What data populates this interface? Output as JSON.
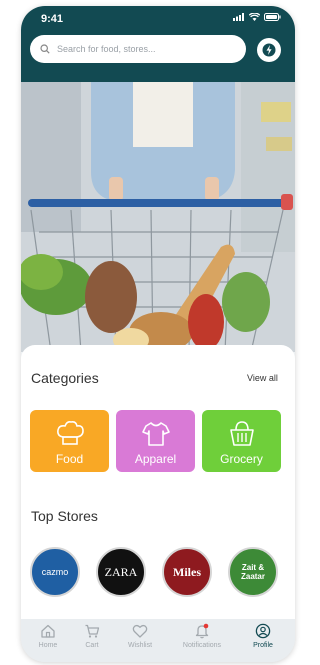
{
  "status": {
    "time": "9:41"
  },
  "search": {
    "placeholder": "Search for food, stores..."
  },
  "categories": {
    "title": "Categories",
    "view_all": "View all",
    "items": [
      {
        "label": "Food",
        "color": "#f9a825"
      },
      {
        "label": "Apparel",
        "color": "#d97ad6"
      },
      {
        "label": "Grocery",
        "color": "#6fcf3a"
      }
    ]
  },
  "top_stores": {
    "title": "Top Stores",
    "items": [
      {
        "logo_text": "cazmo",
        "bg": "#1f5fa3"
      },
      {
        "logo_text": "ZARA",
        "bg": "#111111"
      },
      {
        "logo_text": "Miles",
        "bg": "#8e1a1f"
      },
      {
        "logo_text": "Zait & Zaatar",
        "bg": "#3d8a37"
      }
    ]
  },
  "nav": {
    "items": [
      {
        "label": "Home"
      },
      {
        "label": "Cart"
      },
      {
        "label": "Wishlist"
      },
      {
        "label": "Notifications"
      },
      {
        "label": "Profile"
      }
    ]
  },
  "colors": {
    "header": "#124a52",
    "active_nav": "#124a52"
  }
}
